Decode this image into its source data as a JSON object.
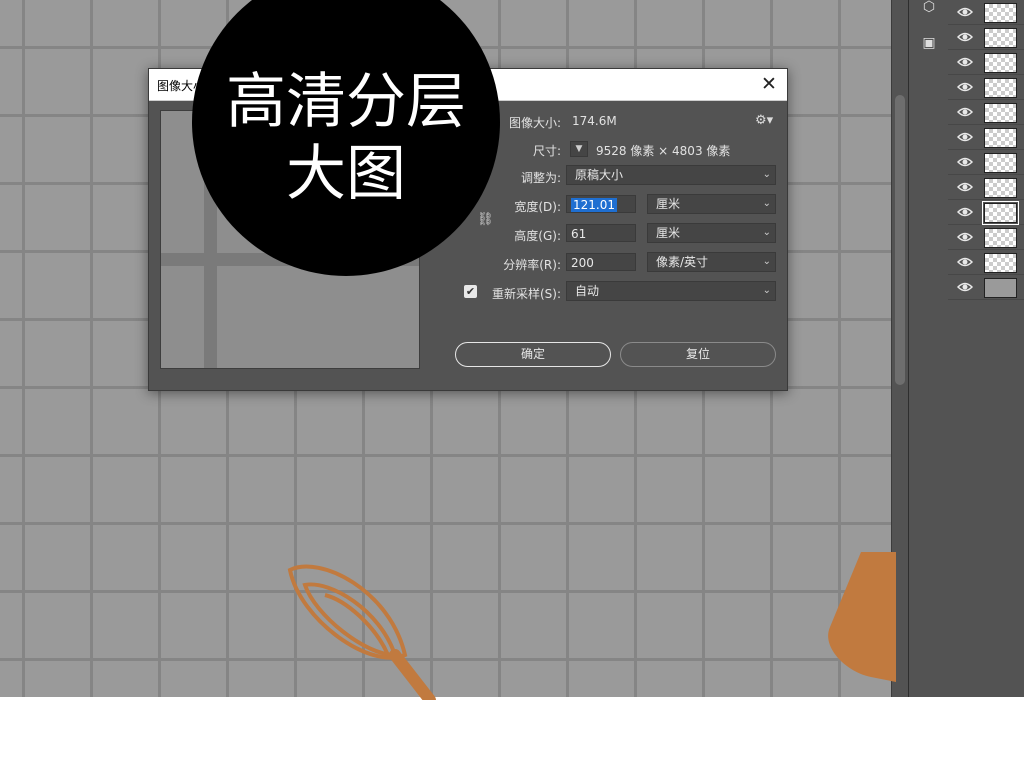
{
  "badge": {
    "line1": "高清分层",
    "line2": "大图"
  },
  "dialog": {
    "title": "图像大小",
    "close": "✕",
    "image_size_label": "图像大小:",
    "image_size_value": "174.6M",
    "dimensions_label": "尺寸:",
    "dimensions_value": "9528 像素 × 4803 像素",
    "fit_to_label": "调整为:",
    "fit_to_value": "原稿大小",
    "width_label": "宽度(D):",
    "width_value": "121.01",
    "width_unit": "厘米",
    "height_label": "高度(G):",
    "height_value": "61",
    "height_unit": "厘米",
    "resolution_label": "分辨率(R):",
    "resolution_value": "200",
    "resolution_unit": "像素/英寸",
    "resample_label": "重新采样(S):",
    "resample_checked": true,
    "resample_value": "自动",
    "ok_label": "确定",
    "reset_label": "复位"
  },
  "layers": {
    "rows": [
      {
        "type": "checker"
      },
      {
        "type": "checker"
      },
      {
        "type": "checker"
      },
      {
        "type": "checker"
      },
      {
        "type": "checker"
      },
      {
        "type": "checker"
      },
      {
        "type": "checker"
      },
      {
        "type": "checker"
      },
      {
        "type": "checker",
        "selected": true
      },
      {
        "type": "checker"
      },
      {
        "type": "checker"
      },
      {
        "type": "gray"
      }
    ]
  },
  "colors": {
    "canvas": "#9a9a9a",
    "grid": "#858585",
    "panel": "#535353",
    "accent": "#c17a3f",
    "selection": "#1f6fd1"
  },
  "icons": [
    "3d-cube-icon",
    "3d-materials-icon",
    "eye-icon",
    "gear-icon",
    "link-icon",
    "close-icon",
    "chevron-down-icon",
    "checkbox-checked-icon"
  ]
}
